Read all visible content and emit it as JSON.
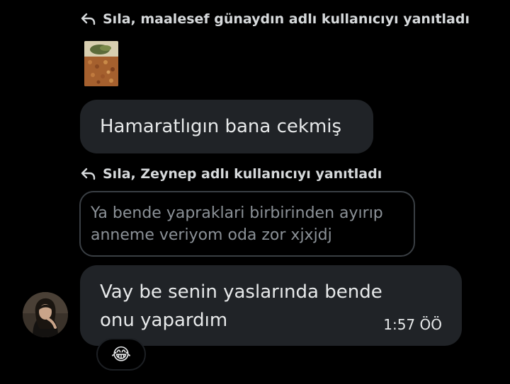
{
  "thread": {
    "reply_header_1": "Sıla, maalesef günaydın adlı kullanıcıyı yanıtladı",
    "message_1": "Hamaratlıgın bana cekmiş",
    "reply_header_2": "Sıla, Zeynep adlı kullanıcıyı yanıtladı",
    "quoted_message": "Ya bende yapraklari birbirinden ayırıp anneme veriyom oda zor xjxjdj",
    "message_2": "Vay be senin yaslarında bende onu yapardım",
    "message_2_time": "1:57 ÖÖ",
    "reaction_emoji": "😂"
  },
  "icons": {
    "reply": "reply-arrow-icon"
  },
  "colors": {
    "background": "#000000",
    "bubble": "#202327",
    "text": "#e7e9ea",
    "muted_text": "#8b9197"
  }
}
